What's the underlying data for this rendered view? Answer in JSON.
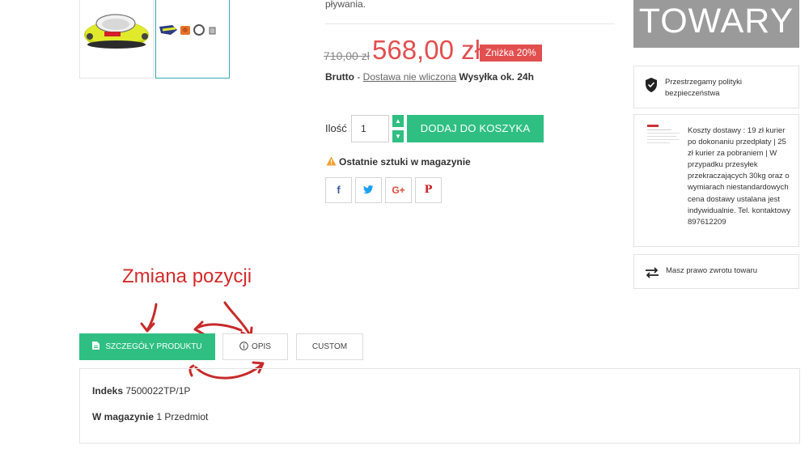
{
  "gallery": {
    "thumbnails": [
      {
        "name": "product-main-thumb",
        "selected": false
      },
      {
        "name": "product-accessories-thumb",
        "selected": true
      }
    ]
  },
  "product": {
    "description_tail": "pływania.",
    "old_price": "710,00 zł",
    "price": "568,00 zł",
    "discount_badge": "Zniżka 20%",
    "brutto_label": "Brutto",
    "brutto_sep": " - ",
    "shipping_link": "Dostawa nie wliczona",
    "dispatch": " Wysyłka ok. 24h",
    "quantity_label": "Ilość",
    "quantity_value": "1",
    "add_to_cart_label": "DODAJ DO KOSZYKA",
    "stock_warning": "Ostatnie sztuki w magazynie",
    "share": [
      {
        "network": "facebook",
        "glyph": "f",
        "color": "#3b5998"
      },
      {
        "network": "twitter",
        "glyph": "t",
        "color": "#1da1f2"
      },
      {
        "network": "google-plus",
        "glyph": "G+",
        "color": "#dd4b39"
      },
      {
        "network": "pinterest",
        "glyph": "P",
        "color": "#cb2027"
      }
    ]
  },
  "sidebar": {
    "banner": "TOWARY",
    "security": "Przestrzegamy polityki bezpieczeństwa",
    "delivery": "Koszty dostawy : 19 zł kurier po dokonaniu przedpłaty | 25 zł kurier za pobraniem | W przypadku przesyłek przekraczających 30kg oraz o wymiarach niestandardowych cena dostawy ustalana jest indywidualnie. Tel. kontaktowy 897612209",
    "returns": "Masz prawo zwrotu towaru"
  },
  "annotation": {
    "text": "Zmiana pozycji",
    "color": "#d42a2a"
  },
  "tabs": [
    {
      "label": "SZCZEGÓŁY PRODUKTU",
      "active": true
    },
    {
      "label": "OPIS",
      "active": false
    },
    {
      "label": "CUSTOM",
      "active": false
    }
  ],
  "details": {
    "index_label": "Indeks",
    "index_value": " 7500022TP/1P",
    "stock_label": "W magazynie",
    "stock_value": " 1 Przedmiot"
  },
  "colors": {
    "accent_green": "#2fbf83",
    "price_red": "#e24f4f",
    "banner_gray": "#9a9a9a"
  }
}
